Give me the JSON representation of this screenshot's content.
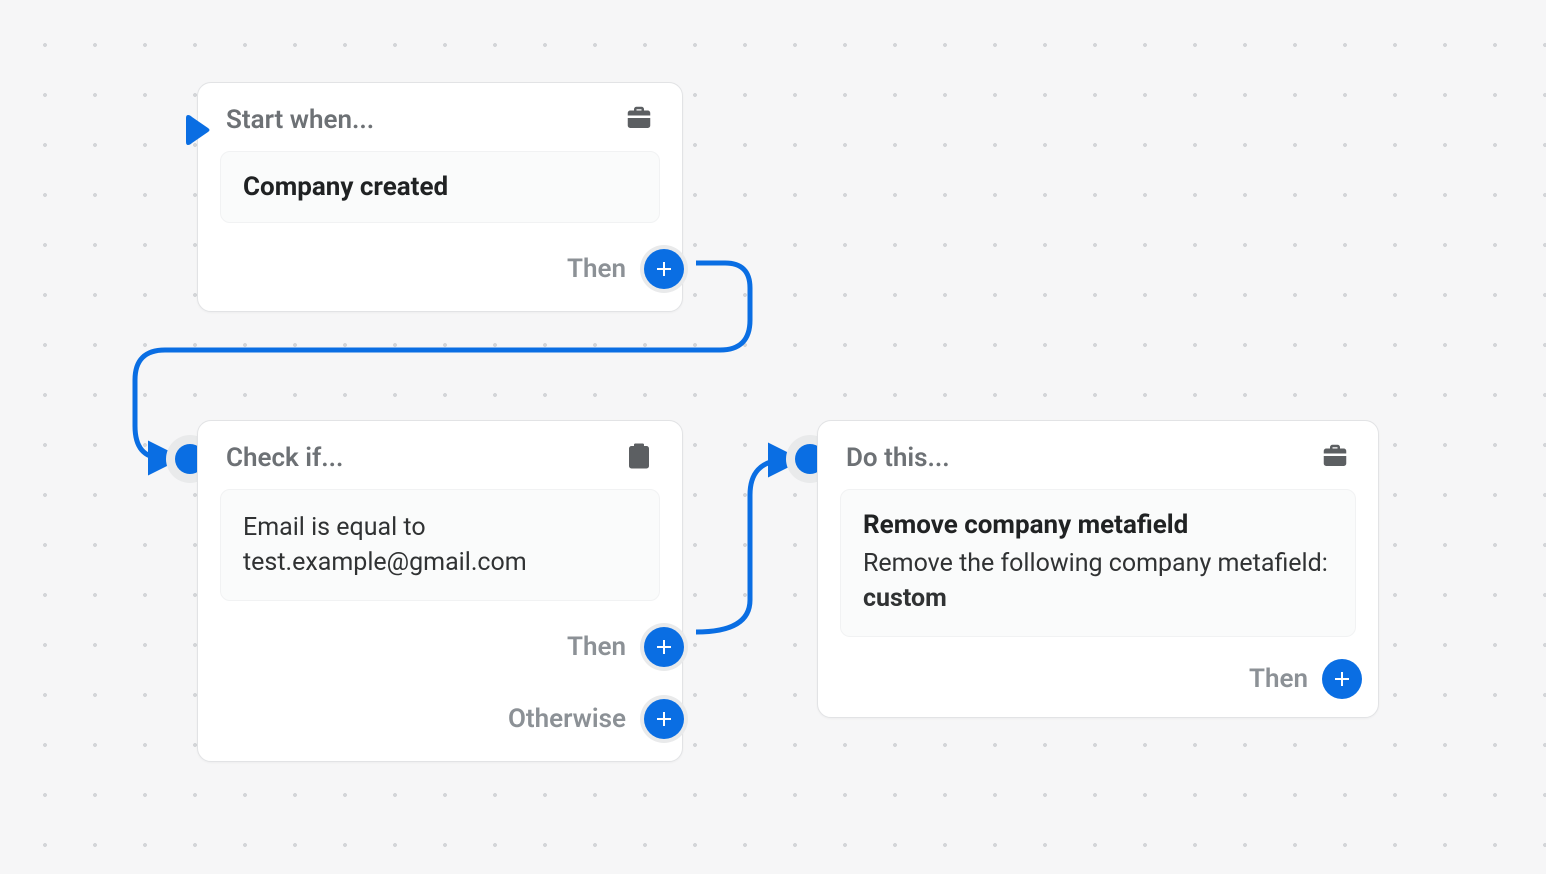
{
  "labels": {
    "then": "Then",
    "otherwise": "Otherwise"
  },
  "trigger": {
    "head": "Start when...",
    "title": "Company created"
  },
  "condition": {
    "head": "Check if...",
    "text": "Email is equal to test.example@gmail.com"
  },
  "action": {
    "head": "Do this...",
    "title": "Remove company metafield",
    "desc_prefix": "Remove the following company metafield: ",
    "desc_bold": "custom"
  }
}
